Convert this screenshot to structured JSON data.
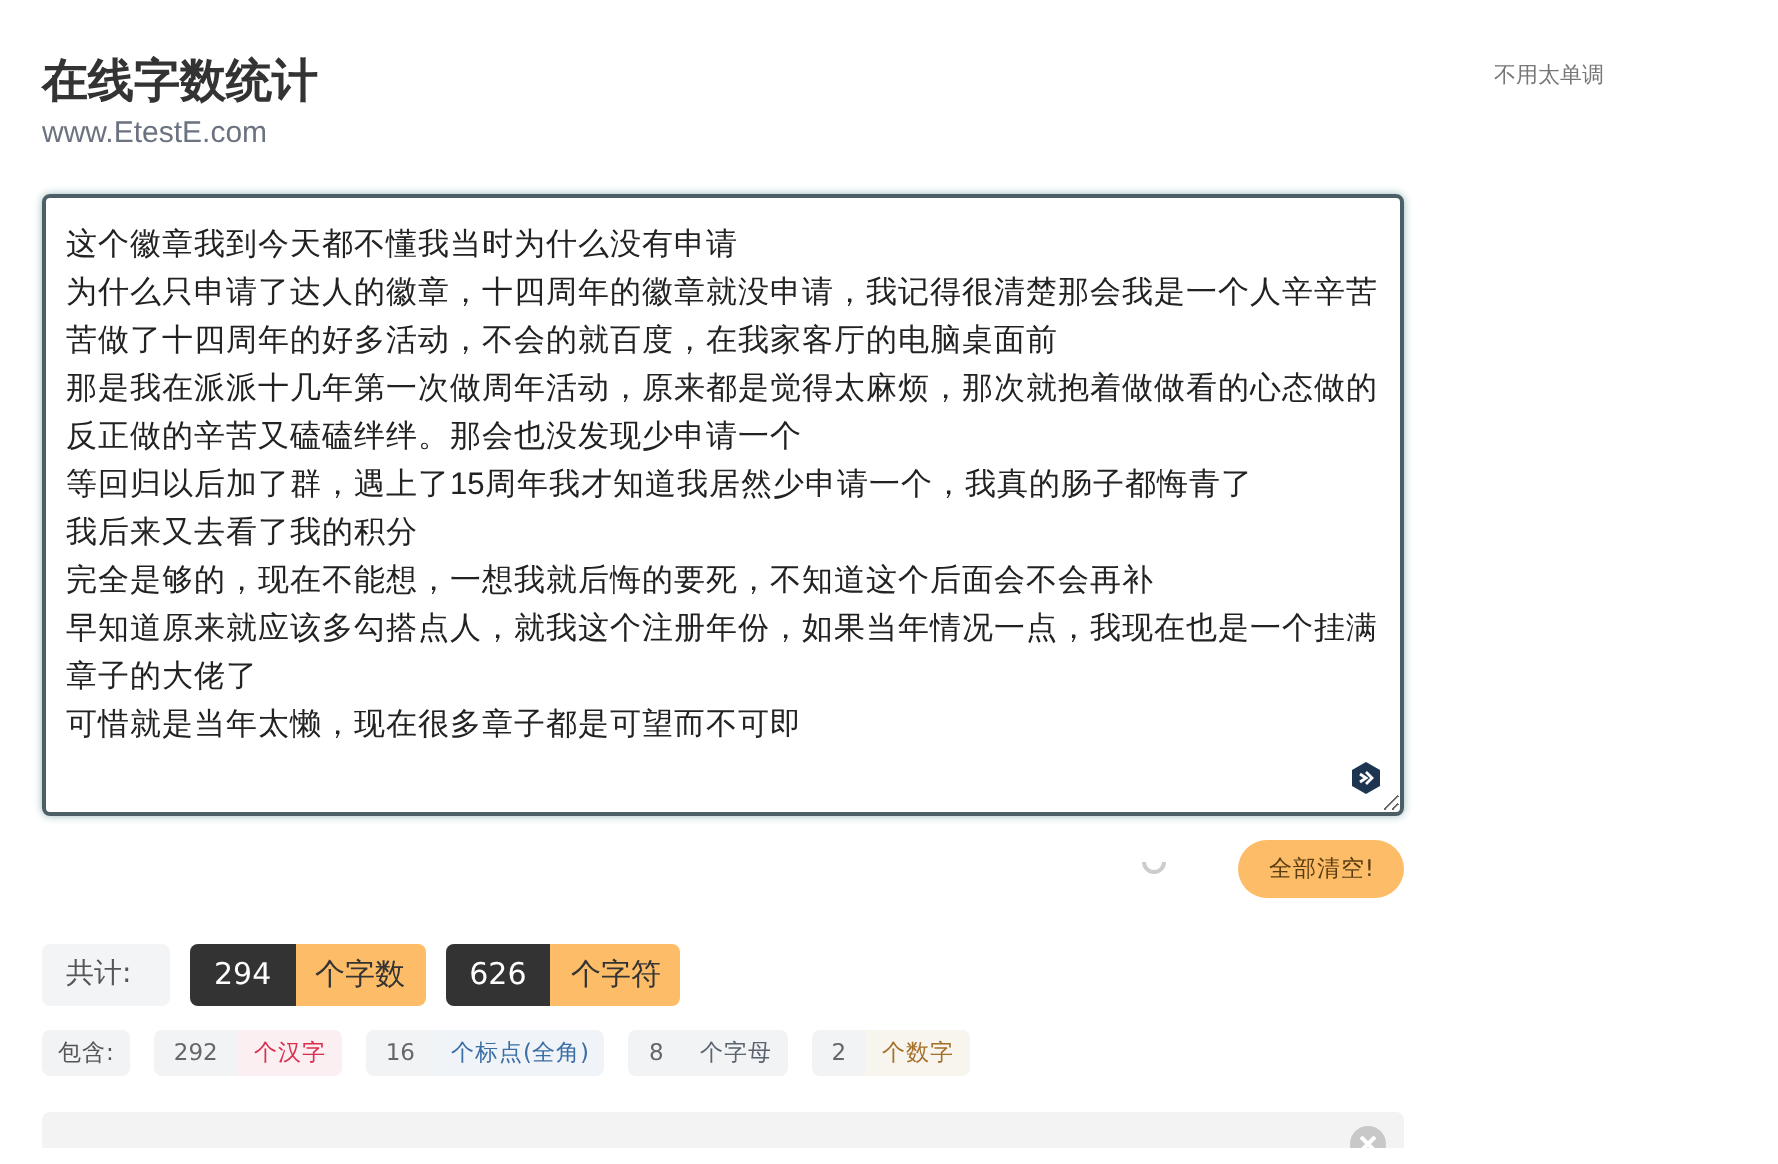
{
  "header": {
    "title": "在线字数统计",
    "subtitle": "www.EtestE.com"
  },
  "side_note": "不用太单调",
  "editor": {
    "lines": [
      "这个徽章我到今天都不懂我当时为什么没有申请",
      "为什么只申请了达人的徽章，十四周年的徽章就没申请，我记得很清楚那会我是一个人辛辛苦苦做了十四周年的好多活动，不会的就百度，在我家客厅的电脑桌面前",
      "那是我在派派十几年第一次做周年活动，原来都是觉得太麻烦，那次就抱着做做看的心态做的反正做的辛苦又磕磕绊绊。那会也没发现少申请一个",
      "等回归以后加了群，遇上了15周年我才知道我居然少申请一个，我真的肠子都悔青了",
      "我后来又去看了我的积分",
      "完全是够的，现在不能想，一想我就后悔的要死，不知道这个后面会不会再补",
      "早知道原来就应该多勾搭点人，就我这个注册年份，如果当年情况一点，我现在也是一个挂满章子的大佬了",
      "可惜就是当年太懒，现在很多章子都是可望而不可即"
    ]
  },
  "clear_button": "全部清空!",
  "totals": {
    "label": "共计:",
    "items": [
      {
        "count": "294",
        "unit": "个字数"
      },
      {
        "count": "626",
        "unit": "个字符"
      }
    ]
  },
  "breakdown": {
    "label": "包含:",
    "items": [
      {
        "count": "292",
        "unit": "个汉字",
        "color": "#d9304f"
      },
      {
        "count": "16",
        "unit": "个标点(全角)",
        "color": "#3a6ea5"
      },
      {
        "count": "8",
        "unit": "个字母",
        "color": "#5b6470"
      },
      {
        "count": "2",
        "unit": "个数字",
        "color": "#a5702a"
      }
    ]
  }
}
